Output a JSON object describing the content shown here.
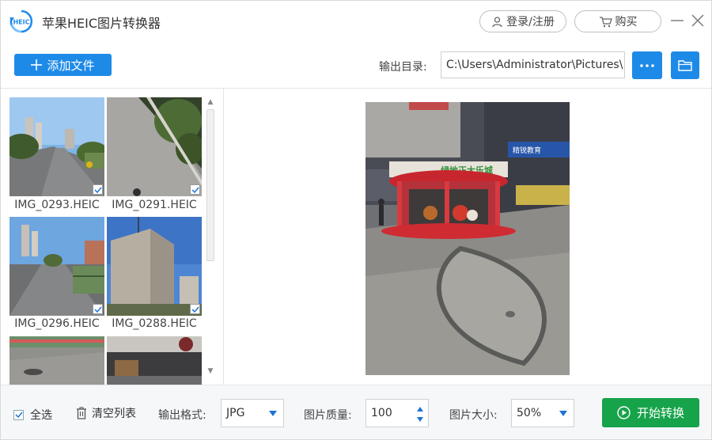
{
  "app": {
    "title": "苹果HEIC图片转换器",
    "logo_text": "HEIC",
    "login_label": "登录/注册",
    "buy_label": "购买"
  },
  "toolbar": {
    "add_files_label": "添加文件",
    "output_dir_label": "输出目录:",
    "output_dir_value": "C:\\Users\\Administrator\\Pictures\\"
  },
  "thumbnails": [
    {
      "name": "IMG_0293.HEIC",
      "checked": true
    },
    {
      "name": "IMG_0291.HEIC",
      "checked": true
    },
    {
      "name": "IMG_0296.HEIC",
      "checked": true
    },
    {
      "name": "IMG_0288.HEIC",
      "checked": true
    },
    {
      "name": "",
      "checked": false
    },
    {
      "name": "",
      "checked": false
    }
  ],
  "preview": {
    "sign_text": "绿地正大乐城",
    "shop_text": "精锐教育"
  },
  "bottom": {
    "select_all_label": "全选",
    "select_all_checked": true,
    "clear_list_label": "清空列表",
    "format_label": "输出格式:",
    "format_value": "JPG",
    "quality_label": "图片质量:",
    "quality_value": "100",
    "size_label": "图片大小:",
    "size_value": "50%",
    "start_label": "开始转换"
  },
  "colors": {
    "accent": "#1e8ae8",
    "start_green": "#17a34a"
  },
  "icons": {
    "logo": "heic-logo-icon",
    "user": "user-icon",
    "cart": "cart-icon",
    "minimize": "minimize-icon",
    "close": "close-icon",
    "plus": "plus-icon",
    "more": "more-dots-icon",
    "folder": "folder-icon",
    "trash": "trash-icon",
    "play": "play-circle-icon"
  }
}
